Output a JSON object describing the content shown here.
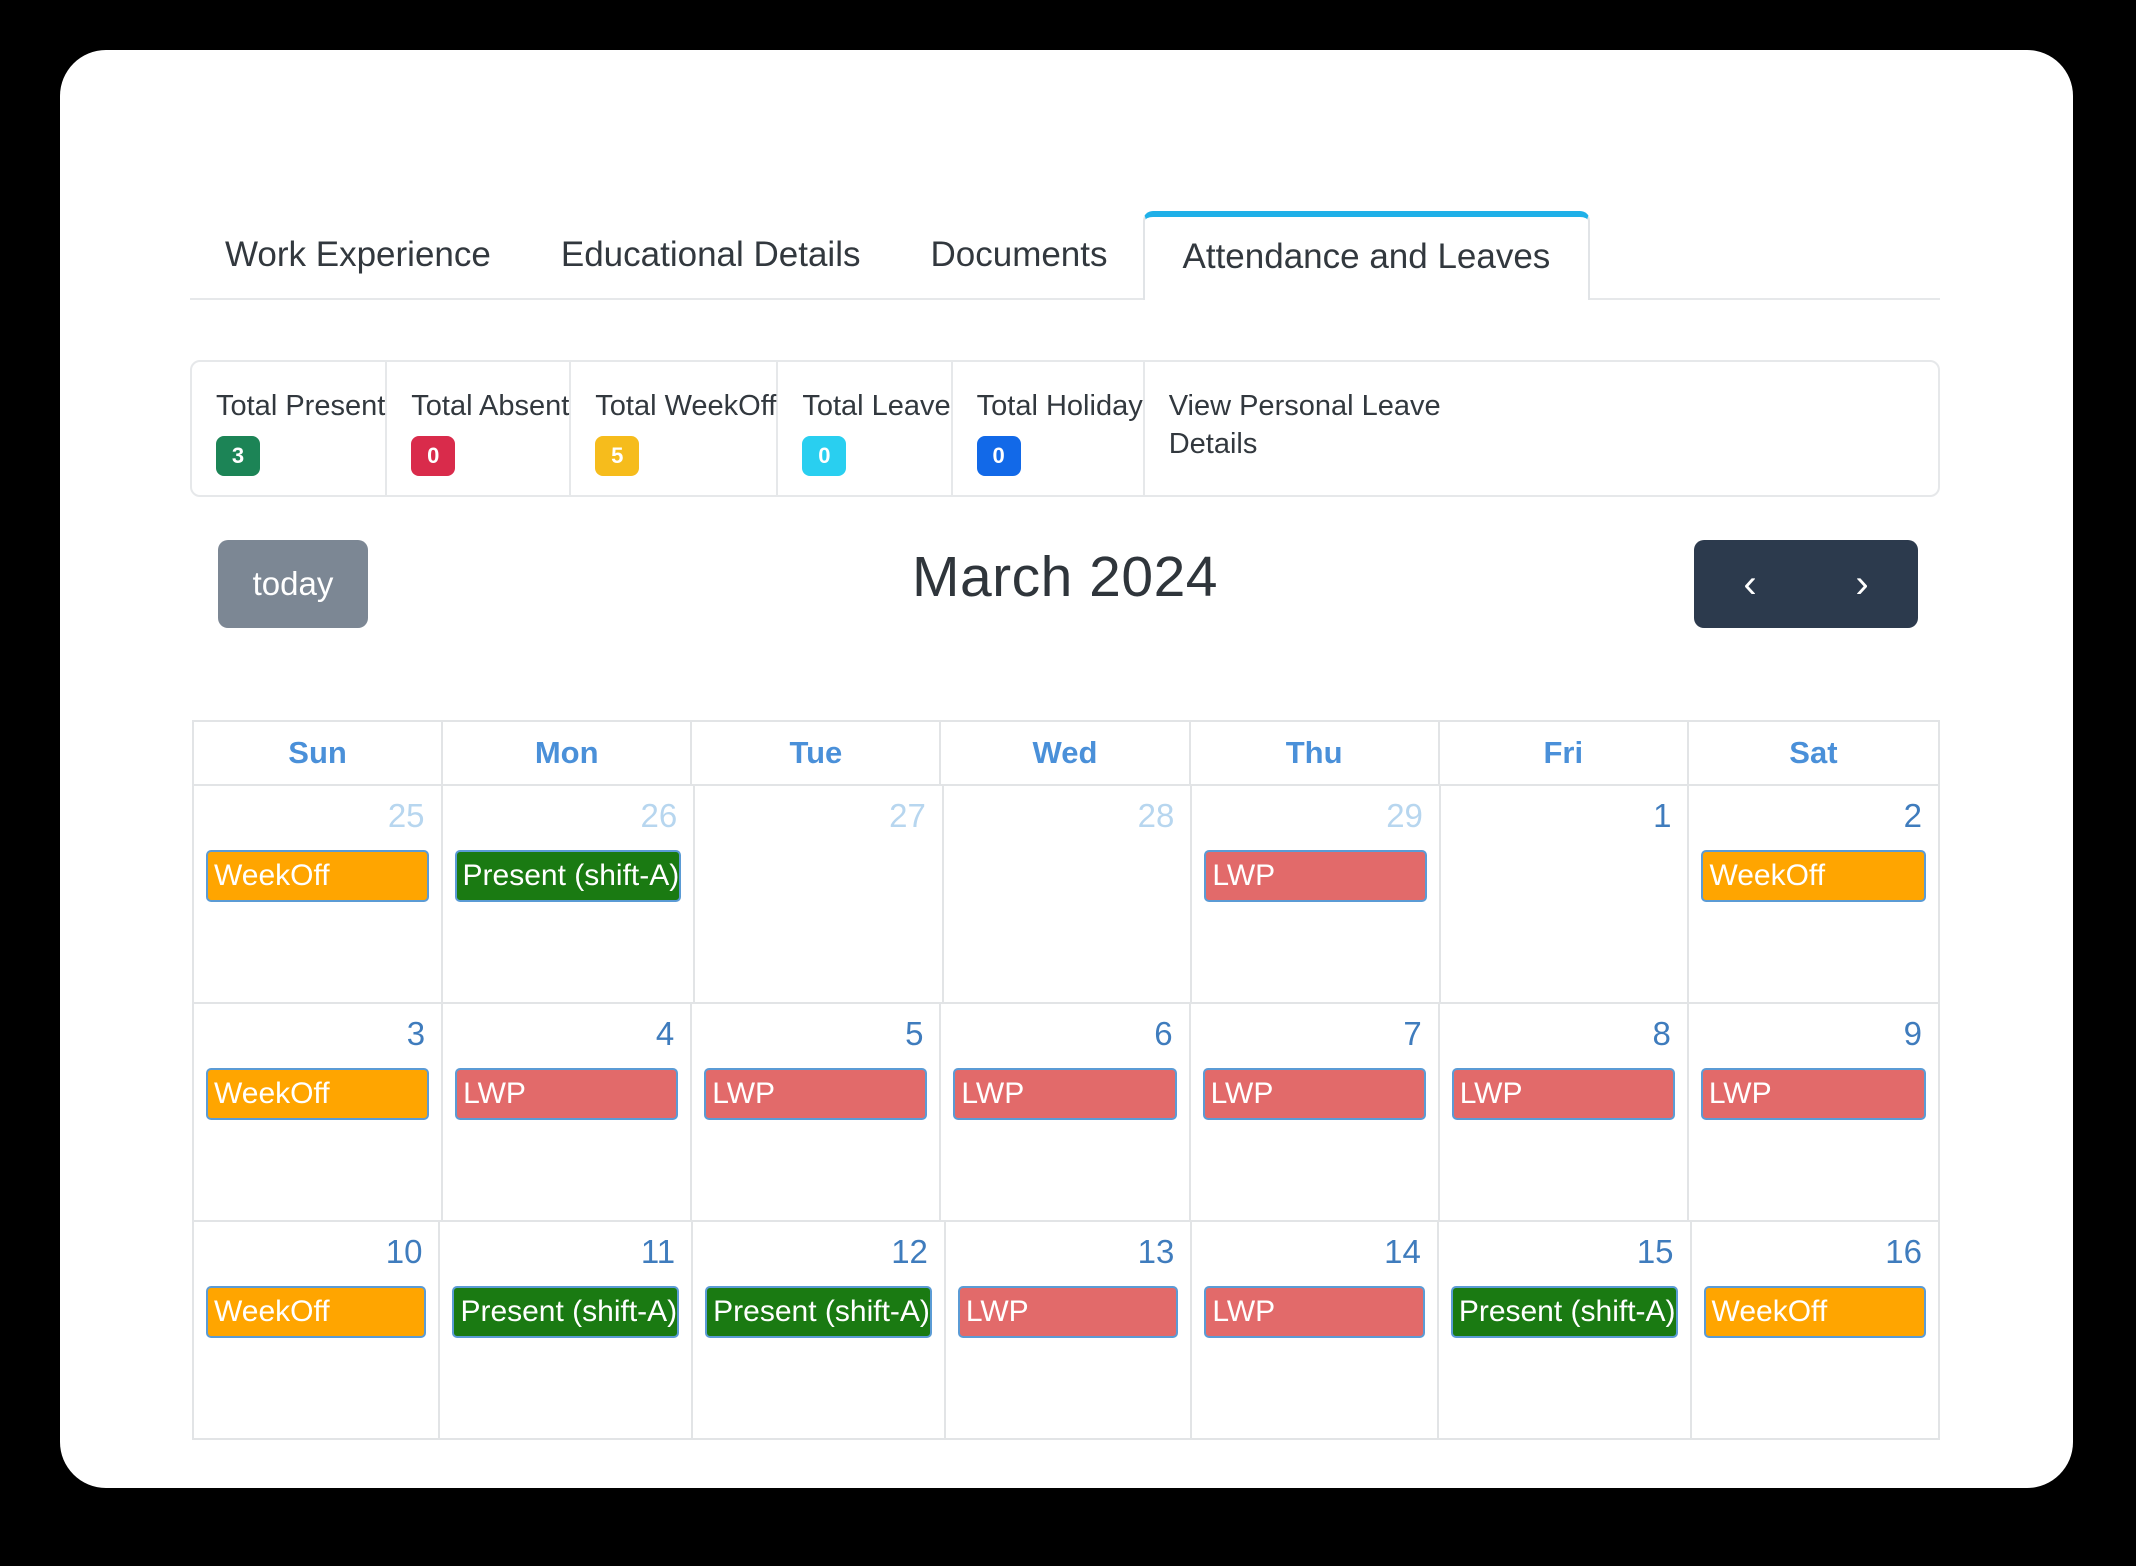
{
  "tabs": [
    {
      "label": "Work Experience",
      "active": false
    },
    {
      "label": "Educational Details",
      "active": false
    },
    {
      "label": "Documents",
      "active": false
    },
    {
      "label": "Attendance and Leaves",
      "active": true
    }
  ],
  "stats": [
    {
      "label": "Total Present",
      "value": "3",
      "color": "#1C8456"
    },
    {
      "label": "Total Absent",
      "value": "0",
      "color": "#D92B4B"
    },
    {
      "label": "Total WeekOff",
      "value": "5",
      "color": "#F6BC1C"
    },
    {
      "label": "Total Leave",
      "value": "0",
      "color": "#29CFF0"
    },
    {
      "label": "Total Holiday",
      "value": "0",
      "color": "#1269E8"
    }
  ],
  "stats_link": "View Personal Leave Details",
  "toolbar": {
    "today_label": "today",
    "title": "March 2024",
    "prev_icon": "‹",
    "next_icon": "›"
  },
  "calendar": {
    "weekday_headers": [
      "Sun",
      "Mon",
      "Tue",
      "Wed",
      "Thu",
      "Fri",
      "Sat"
    ],
    "weeks": [
      [
        {
          "day": "25",
          "other_month": true,
          "event": "WeekOff",
          "type": "weekoff"
        },
        {
          "day": "26",
          "other_month": true,
          "event": "Present (shift-A)",
          "type": "present"
        },
        {
          "day": "27",
          "other_month": true,
          "event": "",
          "type": "empty"
        },
        {
          "day": "28",
          "other_month": true,
          "event": "",
          "type": "empty"
        },
        {
          "day": "29",
          "other_month": true,
          "event": "LWP",
          "type": "lwp"
        },
        {
          "day": "1",
          "other_month": false,
          "event": "",
          "type": "empty"
        },
        {
          "day": "2",
          "other_month": false,
          "event": "WeekOff",
          "type": "weekoff"
        }
      ],
      [
        {
          "day": "3",
          "other_month": false,
          "event": "WeekOff",
          "type": "weekoff"
        },
        {
          "day": "4",
          "other_month": false,
          "event": "LWP",
          "type": "lwp"
        },
        {
          "day": "5",
          "other_month": false,
          "event": "LWP",
          "type": "lwp"
        },
        {
          "day": "6",
          "other_month": false,
          "event": "LWP",
          "type": "lwp"
        },
        {
          "day": "7",
          "other_month": false,
          "event": "LWP",
          "type": "lwp"
        },
        {
          "day": "8",
          "other_month": false,
          "event": "LWP",
          "type": "lwp"
        },
        {
          "day": "9",
          "other_month": false,
          "event": "LWP",
          "type": "lwp"
        }
      ],
      [
        {
          "day": "10",
          "other_month": false,
          "event": "WeekOff",
          "type": "weekoff"
        },
        {
          "day": "11",
          "other_month": false,
          "event": "Present (shift-A)",
          "type": "present"
        },
        {
          "day": "12",
          "other_month": false,
          "event": "Present (shift-A)",
          "type": "present"
        },
        {
          "day": "13",
          "other_month": false,
          "event": "LWP",
          "type": "lwp"
        },
        {
          "day": "14",
          "other_month": false,
          "event": "LWP",
          "type": "lwp"
        },
        {
          "day": "15",
          "other_month": false,
          "event": "Present (shift-A)",
          "type": "present"
        },
        {
          "day": "16",
          "other_month": false,
          "event": "WeekOff",
          "type": "weekoff"
        }
      ]
    ]
  }
}
